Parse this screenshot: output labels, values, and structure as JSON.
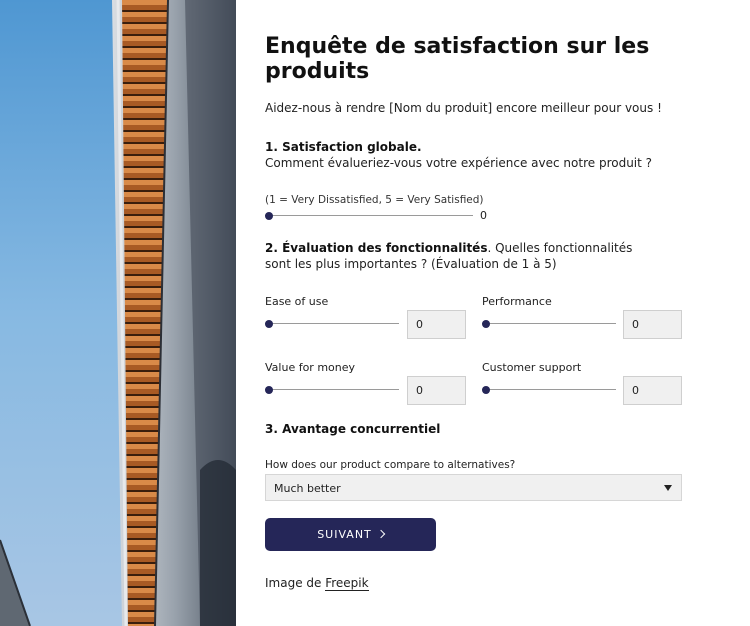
{
  "survey": {
    "title": "Enquête de satisfaction sur les produits",
    "intro": "Aidez-nous à rendre [Nom du produit] encore meilleur pour vous !",
    "q1": {
      "heading": "1. Satisfaction globale.",
      "text": "Comment évalueriez-vous votre expérience avec notre produit ?",
      "scale_hint": "(1 = Very Dissatisfied, 5 = Very Satisfied)",
      "value": "0"
    },
    "q2": {
      "heading": "2. Évaluation des fonctionnalités",
      "text": ". Quelles fonctionnalités sont les plus importantes ? (Évaluation de 1 à 5)",
      "features": [
        {
          "label": "Ease of use",
          "value": "0"
        },
        {
          "label": "Performance",
          "value": "0"
        },
        {
          "label": "Value for money",
          "value": "0"
        },
        {
          "label": "Customer support",
          "value": "0"
        }
      ]
    },
    "q3": {
      "heading": "3. Avantage concurrentiel",
      "select_label": "How does our product compare to alternatives?",
      "select_value": "Much better"
    },
    "next_button": "SUIVANT",
    "credit_prefix": "Image de ",
    "credit_link": "Freepik"
  },
  "colors": {
    "accent": "#252658",
    "field_bg": "#f0f0f0",
    "sky": "#7fb3df"
  },
  "icons": {
    "next": "chevron-right-icon",
    "select": "caret-down-icon",
    "slider_thumb": "dot"
  }
}
